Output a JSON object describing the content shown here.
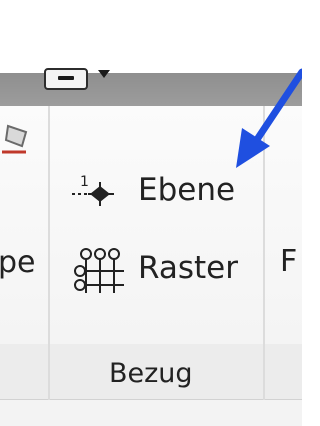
{
  "ribbon": {
    "left_panel_partial_label": "pe",
    "right_panel_partial_label": "F",
    "reference_group": {
      "label": "Bezug",
      "tools": [
        {
          "label": "Ebene",
          "icon": "reference-plane-icon"
        },
        {
          "label": "Raster",
          "icon": "grid-icon"
        }
      ]
    }
  },
  "colors": {
    "toolbar_strip": "#979797",
    "ribbon_bg": "#f7f7f7",
    "footer_bg": "#ececec",
    "annotation_arrow": "#1f4fe0",
    "text": "#222222"
  }
}
